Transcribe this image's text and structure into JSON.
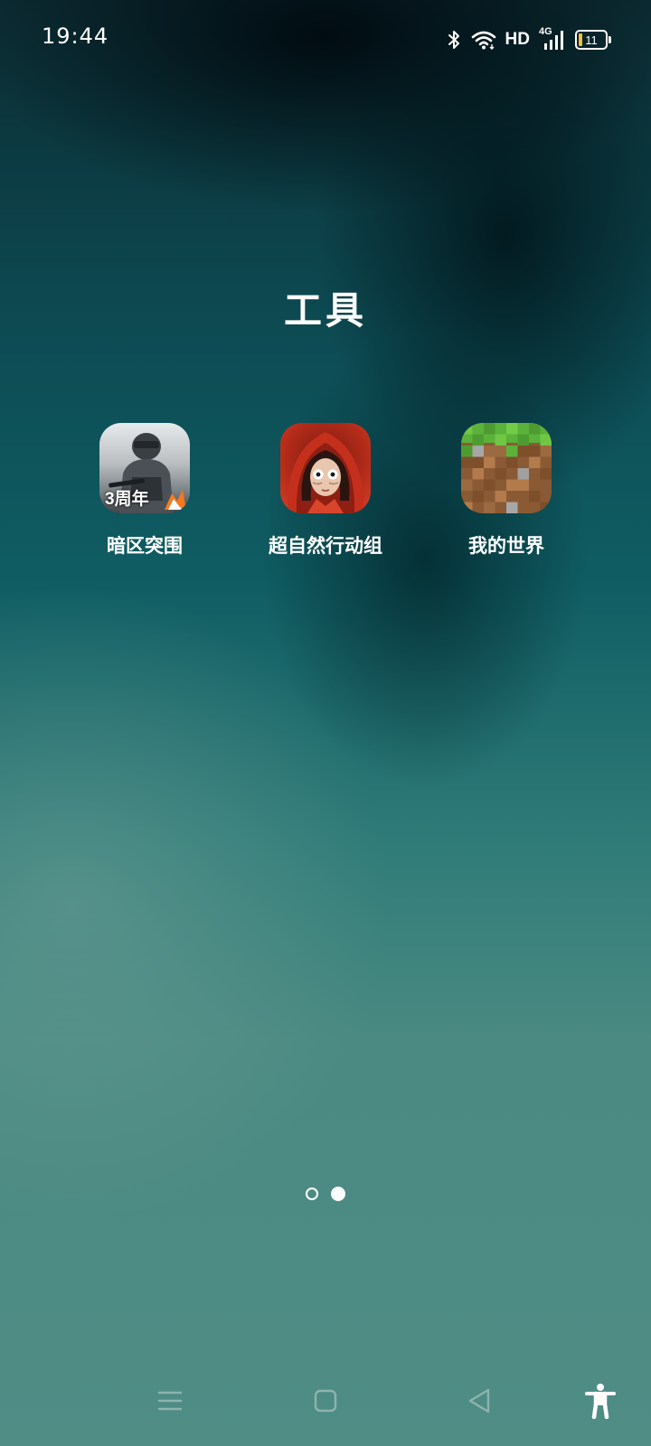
{
  "status_bar": {
    "time": "19:44",
    "network_label": "HD",
    "cellular_label": "4G",
    "battery_level": "11",
    "battery_fill_color": "#f2c230"
  },
  "folder": {
    "title": "工具"
  },
  "apps": [
    {
      "label": "暗区突围",
      "badge": "3周年",
      "icon": "arena-breakout-icon"
    },
    {
      "label": "超自然行动组",
      "icon": "supernatural-squad-icon"
    },
    {
      "label": "我的世界",
      "icon": "minecraft-grass-block-icon"
    }
  ],
  "page_indicator": {
    "total": 2,
    "current": 2
  },
  "nav": {
    "menu": "menu-icon",
    "home": "home-icon",
    "back": "back-icon",
    "accessibility": "accessibility-icon"
  }
}
